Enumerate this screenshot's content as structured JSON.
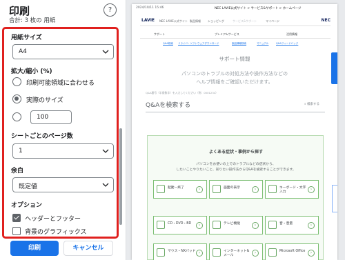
{
  "dialog": {
    "title": "印刷",
    "subtitle": "合計: 3 枚の 用紙",
    "help": "?"
  },
  "paper_size": {
    "label": "用紙サイズ",
    "value": "A4"
  },
  "scale": {
    "label": "拡大/縮小 (%)",
    "options": [
      "印刷可能領域に合わせる",
      "実際のサイズ"
    ],
    "selected": "実際のサイズ",
    "custom_value": "100"
  },
  "pages_per_sheet": {
    "label": "シートごとのページ数",
    "value": "1"
  },
  "margins": {
    "label": "余白",
    "value": "既定値"
  },
  "options": {
    "label": "オプション",
    "headers_footers": {
      "label": "ヘッダーとフッター",
      "checked": true
    },
    "background_graphics": {
      "label": "背景のグラフィックス",
      "checked": false
    }
  },
  "buttons": {
    "print": "印刷",
    "cancel": "キャンセル"
  },
  "preview": {
    "header_date": "2024/10/11 15:46",
    "header_title": "NEC LAVIE公式サイト > サービス&サポート > ホームページ",
    "logo": "LAVIE",
    "brand": "NEC",
    "nav": [
      "NEC LAVIE公式サイト",
      "製品情報",
      "ショッピング",
      "サービス&サポート",
      "マイページ"
    ],
    "subnav": [
      "サポート",
      "プレミアムサービス",
      "活用情報"
    ],
    "links": [
      "Q&A検索",
      "ドライバ・ソフトウェアダウンロード",
      "製品情報検索",
      "マニュアル",
      "Q&Aフィードバック"
    ],
    "support_title": "サポート情報",
    "support_desc_1": "パソコンのトラブルの対処方法や操作方法などの",
    "support_desc_2": "ヘルプ情報をご確認いただけます。",
    "qa_note": "Q&A番号（半角数字）を入力してください（例：0001234）",
    "qa_search": "Q&Aを検索する",
    "qa_button": "検索する",
    "faq_title": "よくある症状・事例から探す",
    "faq_desc_1": "パソコンをお使いの上でのトラブルなどの症状から、",
    "faq_desc_2": "したいことやりたいこと、知りたい操作法からQ&Aを検索することができます。",
    "cards": [
      "起動・終了",
      "画面の表示",
      "キーボード・文字入力",
      "CD・DVD・BD",
      "テレビ機能",
      "音・音量",
      "マウス・NXパッド",
      "インターネット&メール",
      "Microsoft Office"
    ]
  }
}
